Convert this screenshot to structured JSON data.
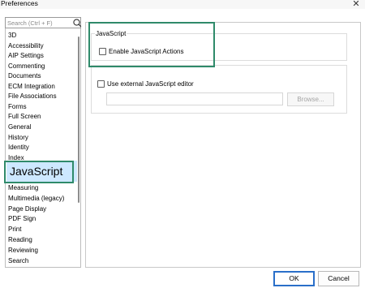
{
  "window": {
    "title": "Preferences",
    "close_glyph": "✕"
  },
  "search": {
    "placeholder": "Search (Ctrl + F)",
    "value": "",
    "icon": "search-icon"
  },
  "nav": {
    "items": [
      "3D",
      "Accessibility",
      "AIP Settings",
      "Commenting",
      "Documents",
      "ECM Integration",
      "File Associations",
      "Forms",
      "Full Screen",
      "General",
      "History",
      "Identity",
      "Index",
      "JavaScript",
      "Measuring",
      "Multimedia (legacy)",
      "Page Display",
      "PDF Sign",
      "Print",
      "Reading",
      "Reviewing",
      "Search"
    ],
    "selected": "JavaScript"
  },
  "panel": {
    "group_title": "JavaScript",
    "enable_js_label": "Enable JavaScript Actions",
    "enable_js_checked": false,
    "external_editor_label": "Use external JavaScript editor",
    "external_editor_checked": false,
    "editor_path_value": "",
    "browse_label": "Browse..."
  },
  "buttons": {
    "ok": "OK",
    "cancel": "Cancel"
  },
  "colors": {
    "highlight": "#2f8a6a",
    "selection": "#cde8ff",
    "ok_border": "#2a6fc9"
  }
}
